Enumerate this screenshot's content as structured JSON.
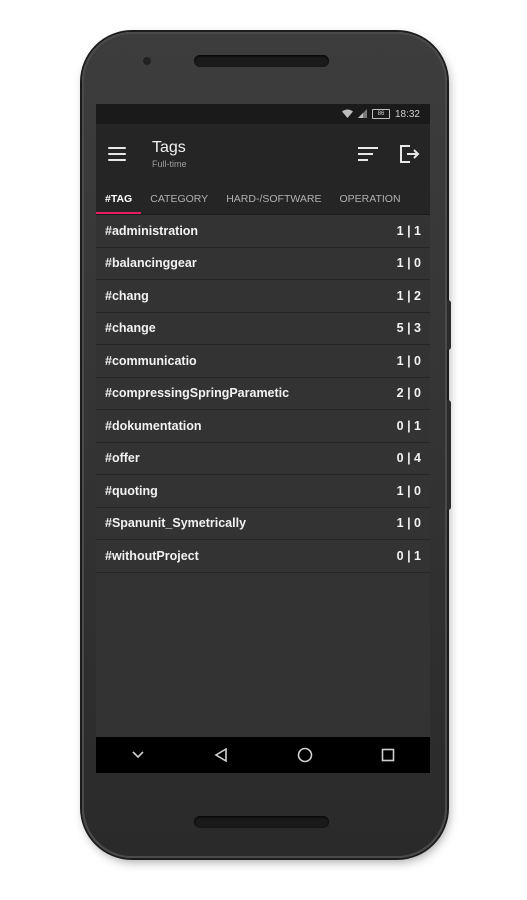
{
  "status_bar": {
    "time": "18:32",
    "battery": "86"
  },
  "app_bar": {
    "title": "Tags",
    "subtitle": "Full-time"
  },
  "tabs": [
    {
      "label": "#TAG",
      "active": true
    },
    {
      "label": "CATEGORY",
      "active": false
    },
    {
      "label": "HARD-/SOFTWARE",
      "active": false
    },
    {
      "label": "OPERATION",
      "active": false
    }
  ],
  "tags": [
    {
      "name": "#administration",
      "count": "1 | 1"
    },
    {
      "name": "#balancinggear",
      "count": "1 | 0"
    },
    {
      "name": "#chang",
      "count": "1 | 2"
    },
    {
      "name": "#change",
      "count": "5 | 3"
    },
    {
      "name": "#communicatio",
      "count": "1 | 0"
    },
    {
      "name": "#compressingSpringParametic",
      "count": "2 | 0"
    },
    {
      "name": "#dokumentation",
      "count": "0 | 1"
    },
    {
      "name": "#offer",
      "count": "0 | 4"
    },
    {
      "name": "#quoting",
      "count": "1 | 0"
    },
    {
      "name": "#Spanunit_Symetrically",
      "count": "1 | 0"
    },
    {
      "name": "#withoutProject",
      "count": "0 | 1"
    }
  ],
  "icons": [
    "menu-icon",
    "sort-icon",
    "logout-icon",
    "wifi-icon",
    "signal-icon",
    "battery-icon",
    "nav-back-icon",
    "nav-home-icon",
    "nav-recents-icon",
    "nav-collapse-icon"
  ],
  "colors": {
    "accent": "#e91e63",
    "app_bar": "#252525",
    "list_bg": "#333333"
  }
}
